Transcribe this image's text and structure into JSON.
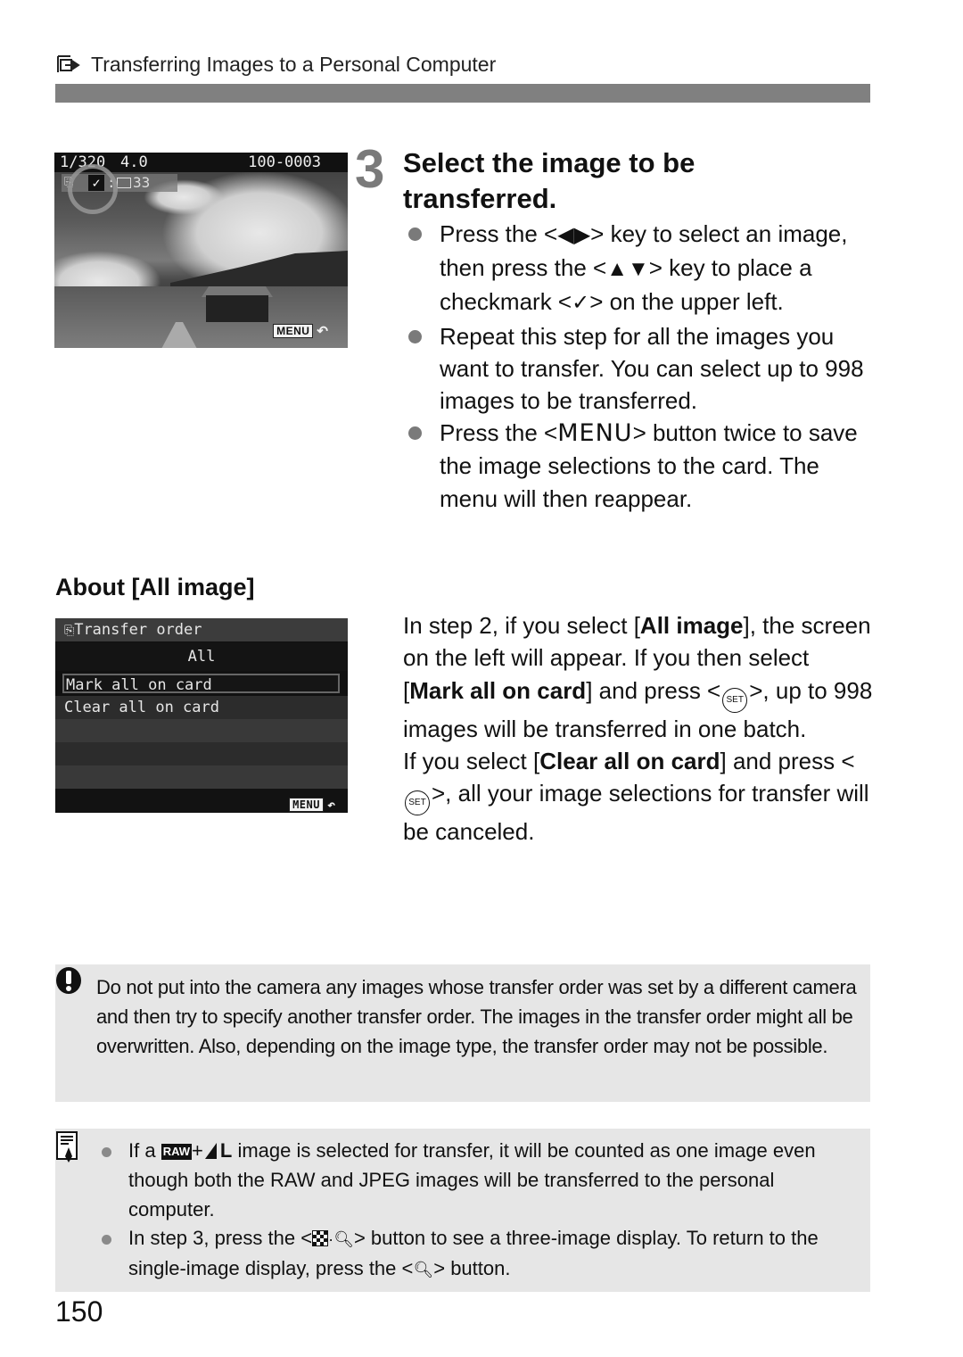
{
  "header": {
    "icon": "transfer-icon",
    "title": "Transferring Images to a Personal Computer"
  },
  "camera_screen_1": {
    "shutter": "1/320",
    "aperture": "4.0",
    "file_number": "100-0003",
    "checkmark": "✓",
    "transfer_count": "33",
    "separator": ":",
    "menu_label": "MENU",
    "return_symbol": "↶"
  },
  "step": {
    "number": "3",
    "title": "Select the image to be transferred.",
    "bullets": [
      {
        "pre": "Press the <",
        "key": "◀▶",
        "mid": "> key to select an image, then press the <",
        "key2": "▲▼",
        "mid2": "> key to place a checkmark <",
        "key3": "✓",
        "post": "> on the upper left."
      },
      {
        "text": "Repeat this step for all the images you want to transfer. You can select up to 998 images to be transferred."
      },
      {
        "pre": "Press the <",
        "key": "MENU",
        "post": "> button twice to save the image selections to the card. The menu will then reappear."
      }
    ]
  },
  "about": {
    "title": "About [All image]",
    "screen": {
      "title": "Transfer order",
      "value": "All",
      "options": [
        "Mark all on card",
        "Clear all on card"
      ],
      "selected_option": "Mark all on card",
      "menu_label": "MENU",
      "return_symbol": "↶"
    },
    "paragraph1": {
      "t1": "In step 2, if you select [",
      "b1": "All image",
      "t2": "], the screen on the left will appear. If you then select [",
      "b2": "Mark all on card",
      "t3": "] and press <",
      "set": "SET",
      "t4": ">, up to 998 images will be transferred in one batch."
    },
    "paragraph2": {
      "t1": "If you select [",
      "b1": "Clear all on card",
      "t2": "] and press <",
      "set": "SET",
      "t3": ">, all your image selections for transfer will be canceled."
    }
  },
  "caution": {
    "icon": "caution-icon",
    "text": "Do not put into the camera any images whose transfer order was set by a different camera and then try to specify another transfer order. The images in the transfer order might all be overwritten. Also, depending on the image type, the transfer order may not be possible."
  },
  "note": {
    "icon": "note-icon",
    "items": [
      {
        "pre": "If a ",
        "raw": "RAW",
        "plus": "+",
        "quality": "L",
        "post": " image is selected for transfer, it will be counted as one image even though both the RAW and JPEG images will be transferred to the personal computer."
      },
      {
        "pre": "In step 3, press the <",
        "post": "> button to see a three-image display. To return to the single-image display, press the <",
        "post2": "> button."
      }
    ]
  },
  "page_number": "150"
}
